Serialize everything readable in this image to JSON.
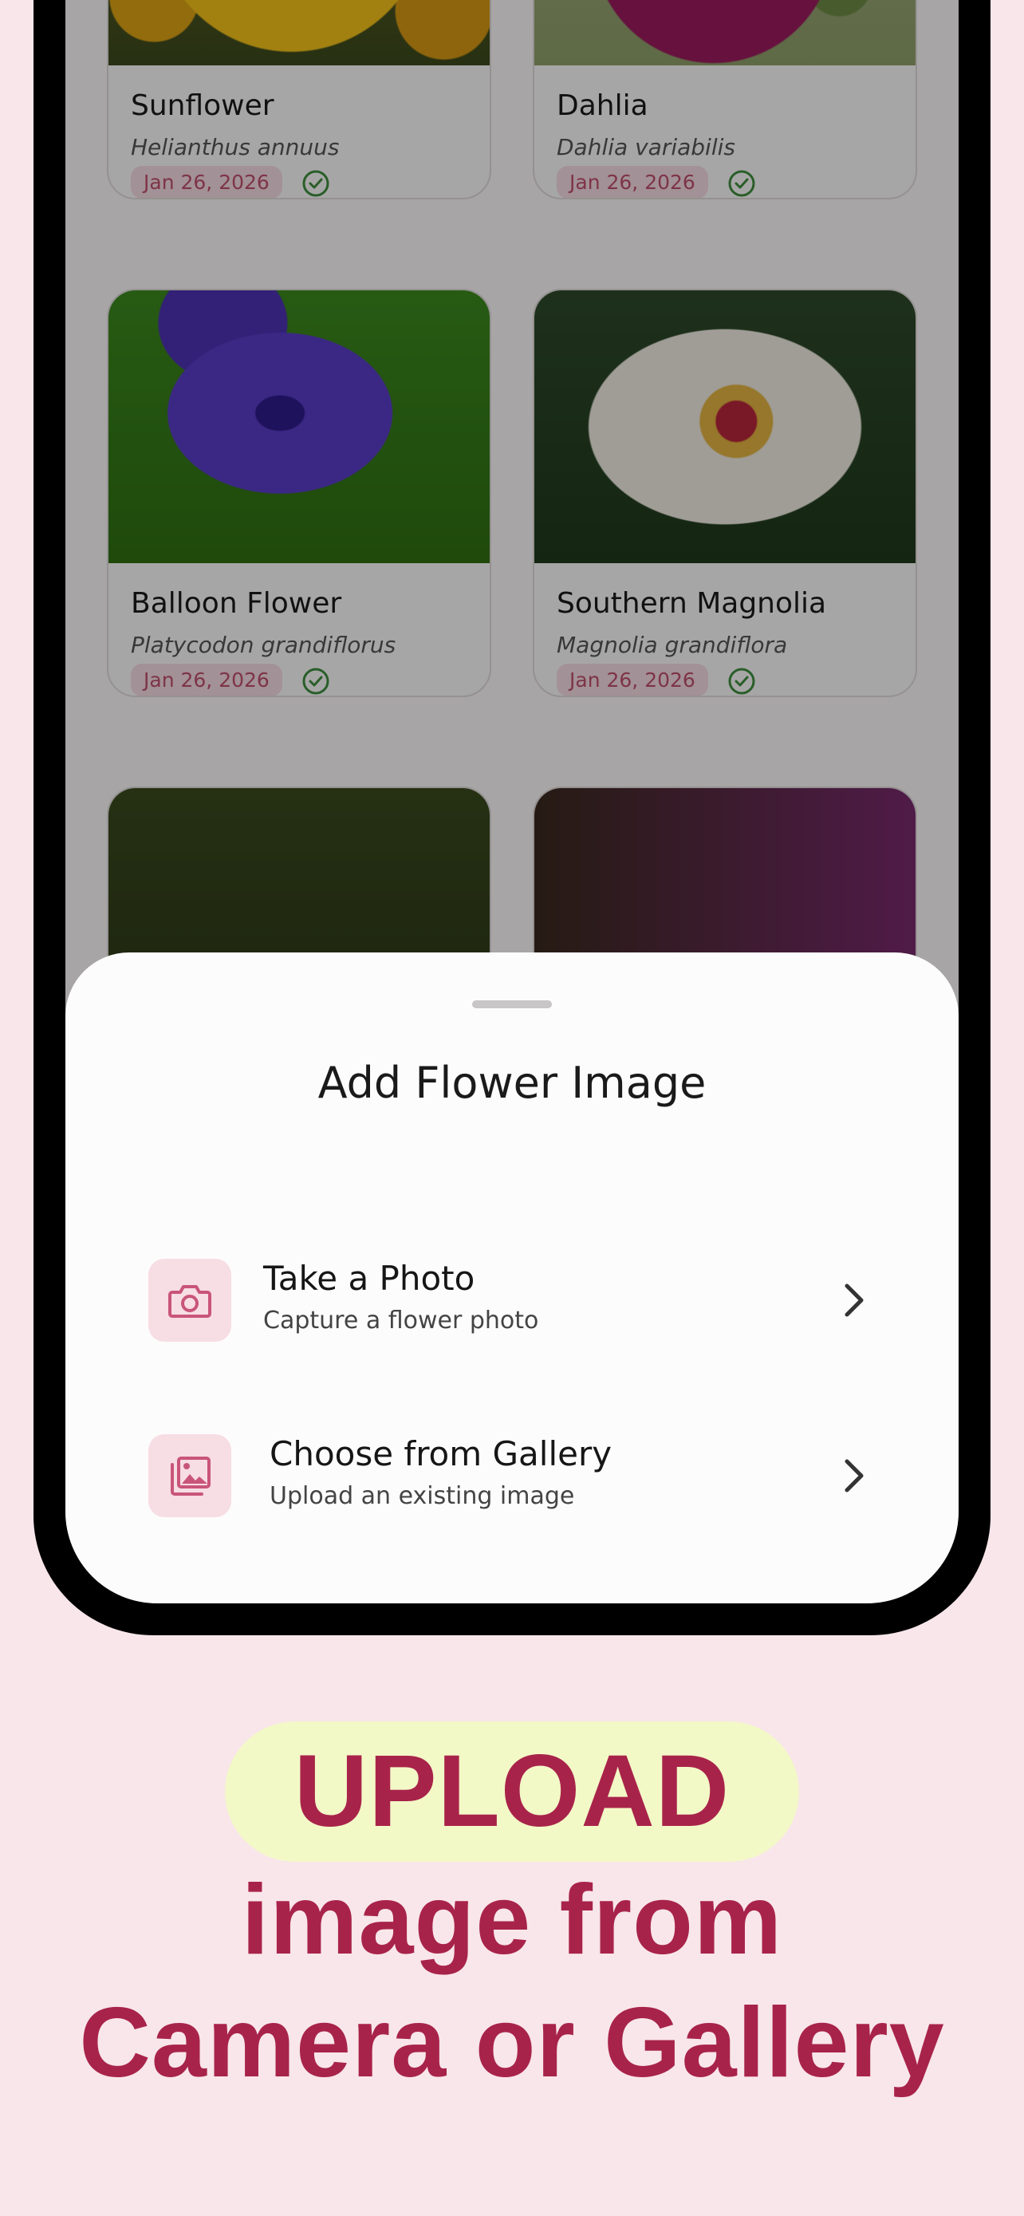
{
  "cards": [
    {
      "name": "Sunflower",
      "scientific": "Helianthus annuus",
      "date": "Jan 26, 2026",
      "status_icon": "check-circle-icon"
    },
    {
      "name": "Dahlia",
      "scientific": "Dahlia variabilis",
      "date": "Jan 26, 2026",
      "status_icon": "check-circle-icon"
    },
    {
      "name": "Balloon Flower",
      "scientific": "Platycodon grandiflorus",
      "date": "Jan 26, 2026",
      "status_icon": "check-circle-icon"
    },
    {
      "name": "Southern Magnolia",
      "scientific": "Magnolia grandiflora",
      "date": "Jan 26, 2026",
      "status_icon": "check-circle-icon"
    }
  ],
  "sheet": {
    "title": "Add Flower Image",
    "options": [
      {
        "label": "Take a Photo",
        "subtitle": "Capture a flower photo",
        "icon": "camera-icon"
      },
      {
        "label": "Choose from Gallery",
        "subtitle": "Upload an existing image",
        "icon": "gallery-icon"
      }
    ]
  },
  "promo": {
    "highlight": "UPLOAD",
    "line2": "image from",
    "line3": "Camera or Gallery"
  },
  "colors": {
    "accent": "#a8234a",
    "icon_bg": "#f7dde4",
    "highlight_bg": "#f3f8c7",
    "background": "#f8e6ea",
    "check": "#3f8f3f"
  }
}
